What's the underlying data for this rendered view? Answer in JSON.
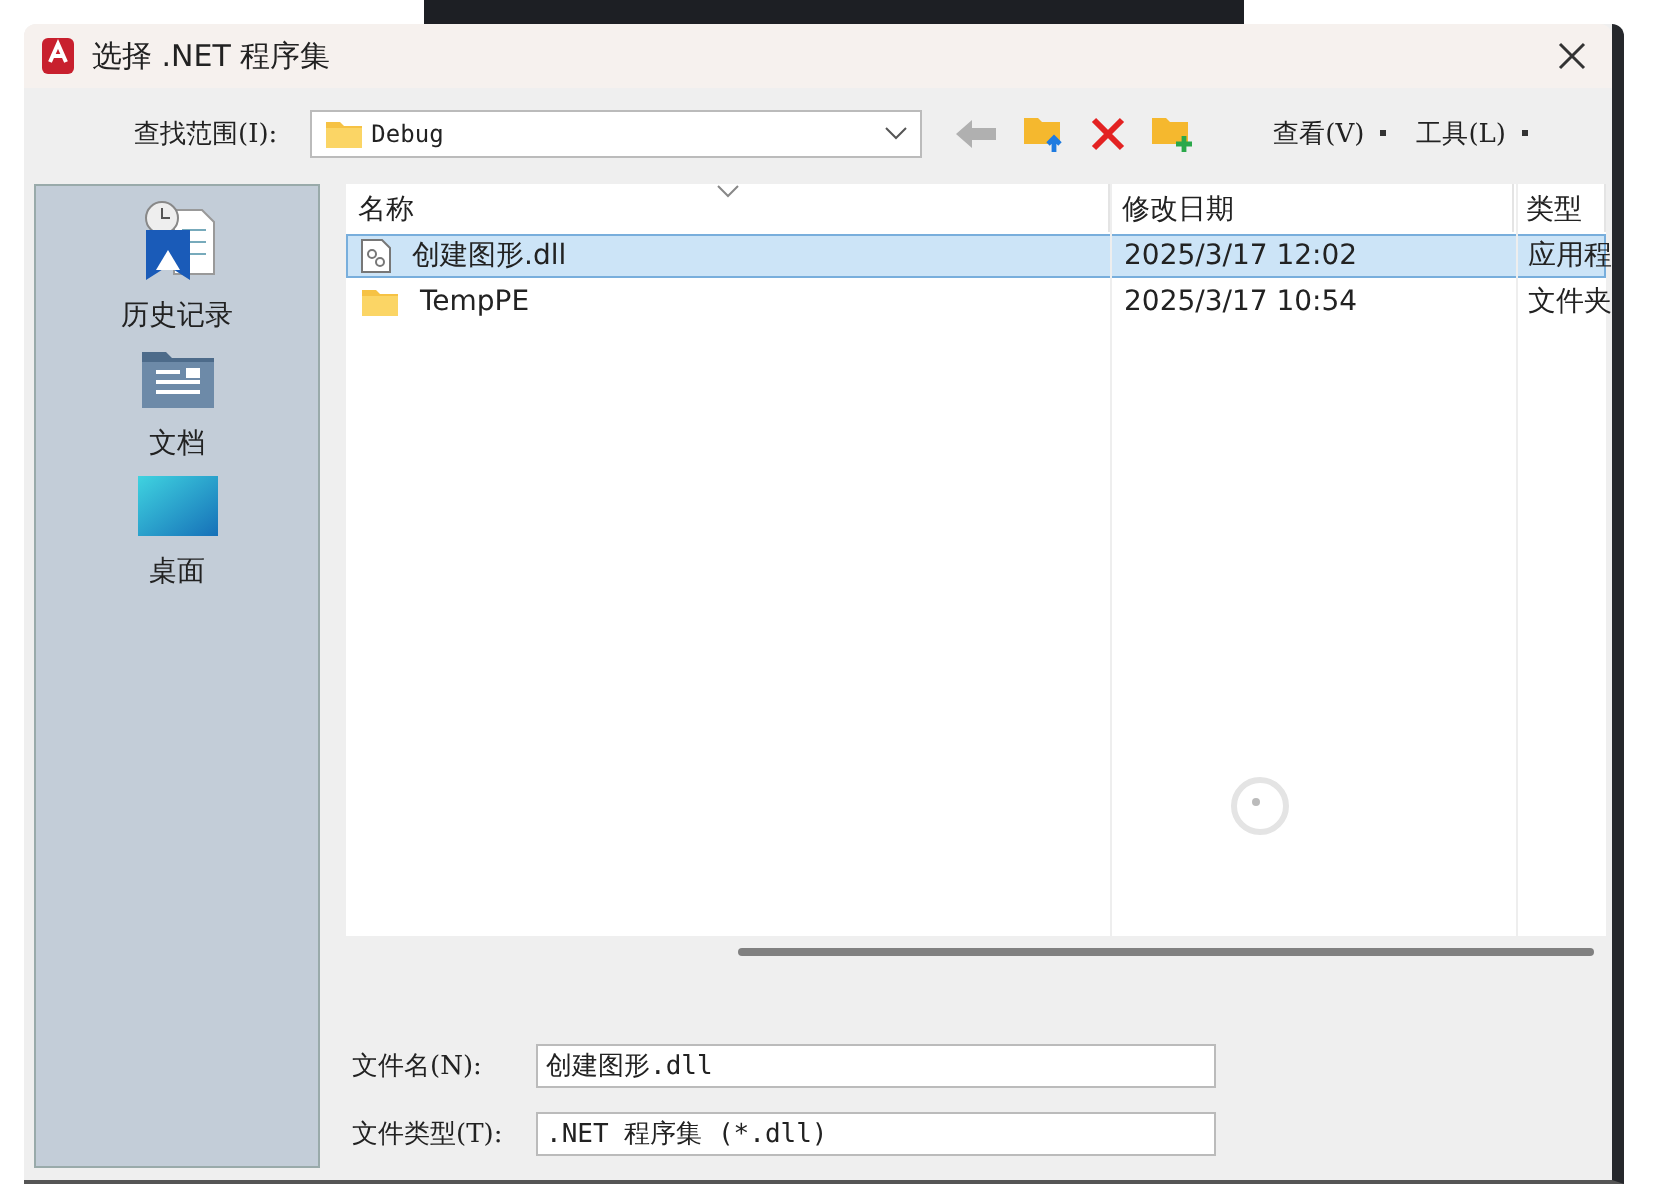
{
  "window": {
    "title": "选择 .NET 程序集"
  },
  "toolbar": {
    "look_in_label": "查找范围(I):",
    "look_in_value": "Debug",
    "view_menu": "查看(V)",
    "tools_menu": "工具(L)"
  },
  "places": [
    {
      "label": "历史记录",
      "kind": "history"
    },
    {
      "label": "文档",
      "kind": "documents"
    },
    {
      "label": "桌面",
      "kind": "desktop"
    }
  ],
  "file_list": {
    "columns": [
      "名称",
      "修改日期",
      "类型"
    ],
    "rows": [
      {
        "name": "创建图形.dll",
        "kind": "dll",
        "modified": "2025/3/17 12:02",
        "type": "应用程",
        "selected": true
      },
      {
        "name": "TempPE",
        "kind": "folder",
        "modified": "2025/3/17 10:54",
        "type": "文件夹",
        "selected": false
      }
    ]
  },
  "file_name": {
    "label": "文件名(N):",
    "value": "创建图形.dll"
  },
  "file_type": {
    "label": "文件类型(T):",
    "value": ".NET 程序集 (*.dll)"
  }
}
